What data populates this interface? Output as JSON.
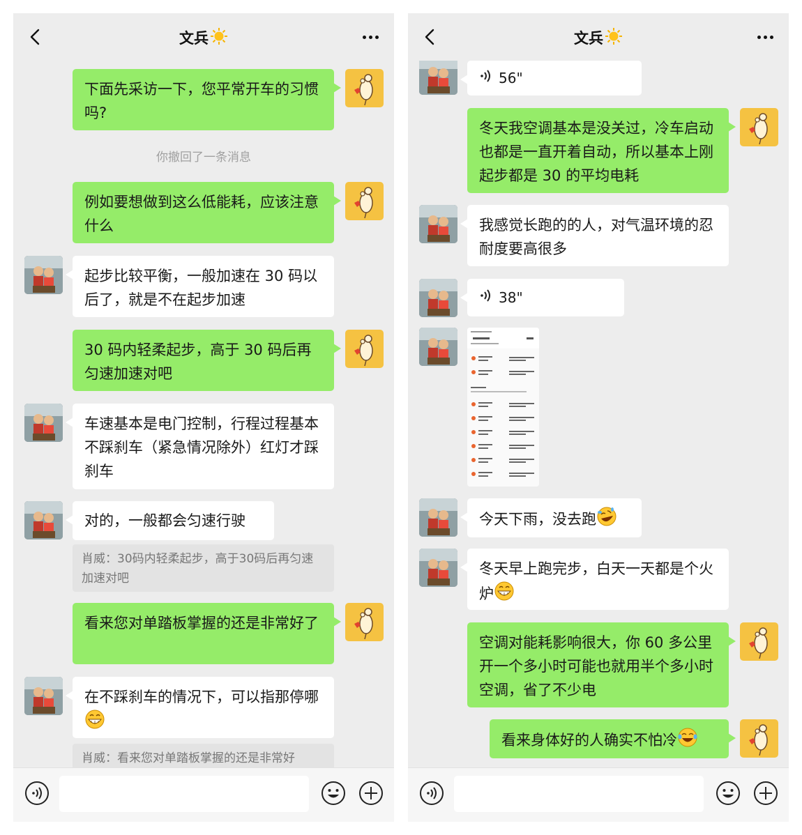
{
  "left": {
    "header": {
      "title": "文兵"
    },
    "messages": {
      "m1": "下面先采访一下，您平常开车的习惯吗?",
      "system": "你撤回了一条消息",
      "m2": "例如要想做到这么低能耗，应该注意什么",
      "m3": "起步比较平衡，一般加速在 30 码以后了，就是不在起步加速",
      "m4": "30 码内轻柔起步，高于 30 码后再匀速加速对吧",
      "m5": "车速基本是电门控制，行程过程基本不踩刹车（紧急情况除外）红灯才踩刹车",
      "m6": "对的，一般都会匀速行驶",
      "q1": "肖威：30码内轻柔起步，高于30码后再匀速加速对吧",
      "m7": "看来您对单踏板掌握的还是非常好了",
      "m8": "在不踩刹车的情况下，可以指那停哪",
      "q2": "肖威：看来您对单踏板掌握的还是非常好"
    }
  },
  "right": {
    "header": {
      "title": "文兵"
    },
    "messages": {
      "v1": "56\"",
      "m1": "冬天我空调基本是没关过，冷车启动也都是一直开着自动，所以基本上刚起步都是 30 的平均电耗",
      "m2": "我感觉长跑的的人，对气温环境的忍耐度要高很多",
      "v2": "38\"",
      "m3": "今天下雨，没去跑",
      "m4": "冬天早上跑完步，白天一天都是个火炉",
      "m5": "空调对能耗影响很大，你 60 多公里开一个多小时可能也就用半个多小时空调，省了不少电",
      "m6": "看来身体好的人确实不怕冷"
    }
  },
  "colors": {
    "me_bubble": "#95ec69",
    "other_bubble": "#ffffff",
    "background": "#ededed"
  }
}
